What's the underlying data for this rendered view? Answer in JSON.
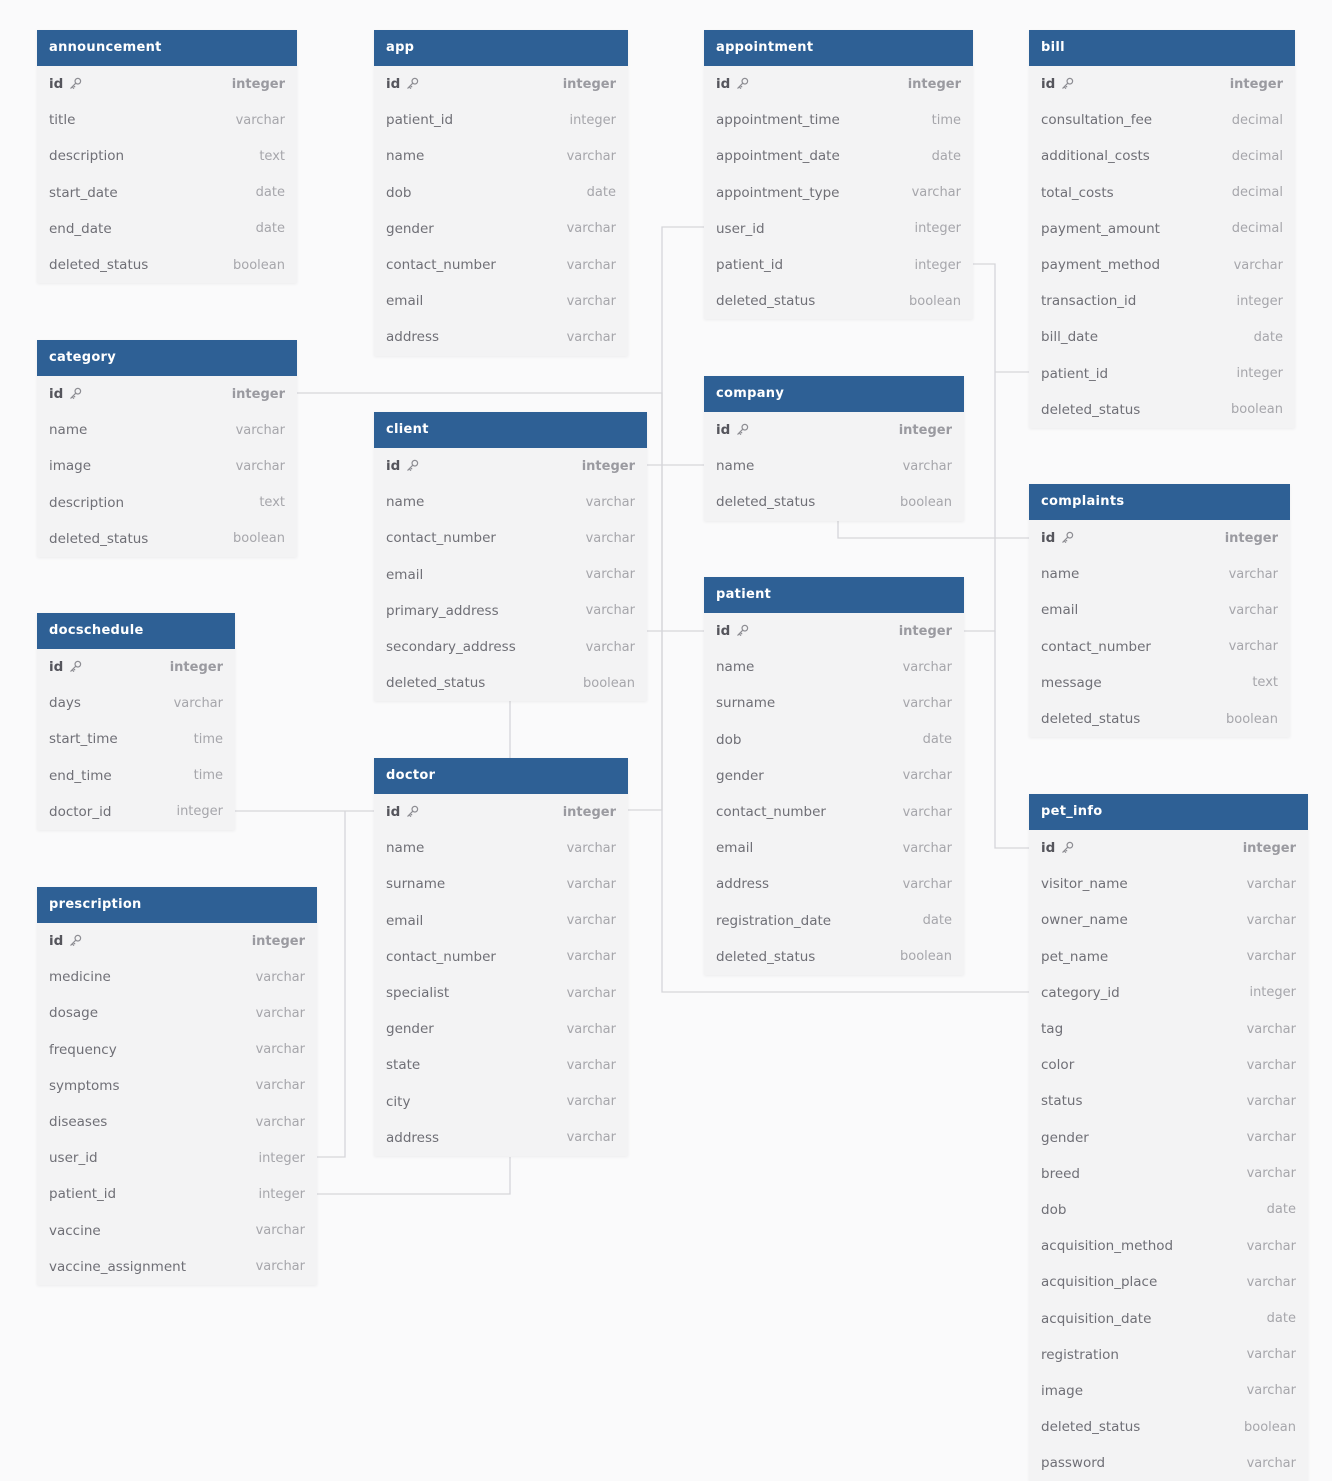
{
  "colors": {
    "header": "#2e6095",
    "body": "#f3f3f4",
    "connector": "#d6d6da",
    "canvas": "#fafafb"
  },
  "icons": {
    "primary_key": "key-icon"
  },
  "tables": [
    {
      "name": "announcement",
      "columns": [
        {
          "name": "id",
          "type": "integer",
          "pk": true
        },
        {
          "name": "title",
          "type": "varchar"
        },
        {
          "name": "description",
          "type": "text"
        },
        {
          "name": "start_date",
          "type": "date"
        },
        {
          "name": "end_date",
          "type": "date"
        },
        {
          "name": "deleted_status",
          "type": "boolean"
        }
      ]
    },
    {
      "name": "app",
      "columns": [
        {
          "name": "id",
          "type": "integer",
          "pk": true
        },
        {
          "name": "patient_id",
          "type": "integer"
        },
        {
          "name": "name",
          "type": "varchar"
        },
        {
          "name": "dob",
          "type": "date"
        },
        {
          "name": "gender",
          "type": "varchar"
        },
        {
          "name": "contact_number",
          "type": "varchar"
        },
        {
          "name": "email",
          "type": "varchar"
        },
        {
          "name": "address",
          "type": "varchar"
        }
      ]
    },
    {
      "name": "appointment",
      "columns": [
        {
          "name": "id",
          "type": "integer",
          "pk": true
        },
        {
          "name": "appointment_time",
          "type": "time"
        },
        {
          "name": "appointment_date",
          "type": "date"
        },
        {
          "name": "appointment_type",
          "type": "varchar"
        },
        {
          "name": "user_id",
          "type": "integer"
        },
        {
          "name": "patient_id",
          "type": "integer"
        },
        {
          "name": "deleted_status",
          "type": "boolean"
        }
      ]
    },
    {
      "name": "bill",
      "columns": [
        {
          "name": "id",
          "type": "integer",
          "pk": true
        },
        {
          "name": "consultation_fee",
          "type": "decimal"
        },
        {
          "name": "additional_costs",
          "type": "decimal"
        },
        {
          "name": "total_costs",
          "type": "decimal"
        },
        {
          "name": "payment_amount",
          "type": "decimal"
        },
        {
          "name": "payment_method",
          "type": "varchar"
        },
        {
          "name": "transaction_id",
          "type": "integer"
        },
        {
          "name": "bill_date",
          "type": "date"
        },
        {
          "name": "patient_id",
          "type": "integer"
        },
        {
          "name": "deleted_status",
          "type": "boolean"
        }
      ]
    },
    {
      "name": "category",
      "columns": [
        {
          "name": "id",
          "type": "integer",
          "pk": true
        },
        {
          "name": "name",
          "type": "varchar"
        },
        {
          "name": "image",
          "type": "varchar"
        },
        {
          "name": "description",
          "type": "text"
        },
        {
          "name": "deleted_status",
          "type": "boolean"
        }
      ]
    },
    {
      "name": "client",
      "columns": [
        {
          "name": "id",
          "type": "integer",
          "pk": true
        },
        {
          "name": "name",
          "type": "varchar"
        },
        {
          "name": "contact_number",
          "type": "varchar"
        },
        {
          "name": "email",
          "type": "varchar"
        },
        {
          "name": "primary_address",
          "type": "varchar"
        },
        {
          "name": "secondary_address",
          "type": "varchar"
        },
        {
          "name": "deleted_status",
          "type": "boolean"
        }
      ]
    },
    {
      "name": "company",
      "columns": [
        {
          "name": "id",
          "type": "integer",
          "pk": true
        },
        {
          "name": "name",
          "type": "varchar"
        },
        {
          "name": "deleted_status",
          "type": "boolean"
        }
      ]
    },
    {
      "name": "complaints",
      "columns": [
        {
          "name": "id",
          "type": "integer",
          "pk": true
        },
        {
          "name": "name",
          "type": "varchar"
        },
        {
          "name": "email",
          "type": "varchar"
        },
        {
          "name": "contact_number",
          "type": "varchar"
        },
        {
          "name": "message",
          "type": "text"
        },
        {
          "name": "deleted_status",
          "type": "boolean"
        }
      ]
    },
    {
      "name": "docschedule",
      "columns": [
        {
          "name": "id",
          "type": "integer",
          "pk": true
        },
        {
          "name": "days",
          "type": "varchar"
        },
        {
          "name": "start_time",
          "type": "time"
        },
        {
          "name": "end_time",
          "type": "time"
        },
        {
          "name": "doctor_id",
          "type": "integer"
        }
      ]
    },
    {
      "name": "patient",
      "columns": [
        {
          "name": "id",
          "type": "integer",
          "pk": true
        },
        {
          "name": "name",
          "type": "varchar"
        },
        {
          "name": "surname",
          "type": "varchar"
        },
        {
          "name": "dob",
          "type": "date"
        },
        {
          "name": "gender",
          "type": "varchar"
        },
        {
          "name": "contact_number",
          "type": "varchar"
        },
        {
          "name": "email",
          "type": "varchar"
        },
        {
          "name": "address",
          "type": "varchar"
        },
        {
          "name": "registration_date",
          "type": "date"
        },
        {
          "name": "deleted_status",
          "type": "boolean"
        }
      ]
    },
    {
      "name": "doctor",
      "columns": [
        {
          "name": "id",
          "type": "integer",
          "pk": true
        },
        {
          "name": "name",
          "type": "varchar"
        },
        {
          "name": "surname",
          "type": "varchar"
        },
        {
          "name": "email",
          "type": "varchar"
        },
        {
          "name": "contact_number",
          "type": "varchar"
        },
        {
          "name": "specialist",
          "type": "varchar"
        },
        {
          "name": "gender",
          "type": "varchar"
        },
        {
          "name": "state",
          "type": "varchar"
        },
        {
          "name": "city",
          "type": "varchar"
        },
        {
          "name": "address",
          "type": "varchar"
        }
      ]
    },
    {
      "name": "pet_info",
      "columns": [
        {
          "name": "id",
          "type": "integer",
          "pk": true
        },
        {
          "name": "visitor_name",
          "type": "varchar"
        },
        {
          "name": "owner_name",
          "type": "varchar"
        },
        {
          "name": "pet_name",
          "type": "varchar"
        },
        {
          "name": "category_id",
          "type": "integer"
        },
        {
          "name": "tag",
          "type": "varchar"
        },
        {
          "name": "color",
          "type": "varchar"
        },
        {
          "name": "status",
          "type": "varchar"
        },
        {
          "name": "gender",
          "type": "varchar"
        },
        {
          "name": "breed",
          "type": "varchar"
        },
        {
          "name": "dob",
          "type": "date"
        },
        {
          "name": "acquisition_method",
          "type": "varchar"
        },
        {
          "name": "acquisition_place",
          "type": "varchar"
        },
        {
          "name": "acquisition_date",
          "type": "date"
        },
        {
          "name": "registration",
          "type": "varchar"
        },
        {
          "name": "image",
          "type": "varchar"
        },
        {
          "name": "deleted_status",
          "type": "boolean"
        },
        {
          "name": "password",
          "type": "varchar"
        }
      ]
    },
    {
      "name": "prescription",
      "columns": [
        {
          "name": "id",
          "type": "integer",
          "pk": true
        },
        {
          "name": "medicine",
          "type": "varchar"
        },
        {
          "name": "dosage",
          "type": "varchar"
        },
        {
          "name": "frequency",
          "type": "varchar"
        },
        {
          "name": "symptoms",
          "type": "varchar"
        },
        {
          "name": "diseases",
          "type": "varchar"
        },
        {
          "name": "user_id",
          "type": "integer"
        },
        {
          "name": "patient_id",
          "type": "integer"
        },
        {
          "name": "vaccine",
          "type": "varchar"
        },
        {
          "name": "vaccine_assignment",
          "type": "varchar"
        }
      ]
    }
  ]
}
